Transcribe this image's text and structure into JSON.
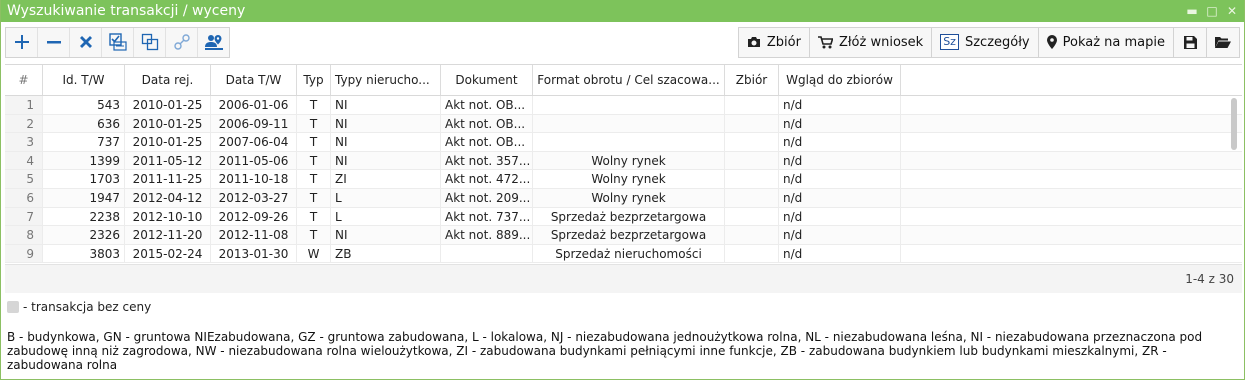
{
  "window": {
    "title": "Wyszukiwanie transakcji / wyceny"
  },
  "toolbar": {
    "left_icons": [
      "plus-icon",
      "minus-icon",
      "close-icon",
      "select-all-icon",
      "copy-icon",
      "link-icon",
      "map-person-icon"
    ],
    "right": {
      "zbior": "Zbiór",
      "wniosek": "Złóż wniosek",
      "szczegoly_badge": "Sz",
      "szczegoly": "Szczegóły",
      "mapa": "Pokaż na mapie"
    }
  },
  "grid": {
    "columns": [
      "#",
      "Id. T/W",
      "Data rej.",
      "Data T/W",
      "Typ",
      "Typy nierucho...",
      "Dokument",
      "Format obrotu / Cel szacowa...",
      "Zbiór",
      "Wgląd do zbiorów"
    ],
    "rows": [
      {
        "n": "1",
        "id": "543",
        "rej": "2010-01-25",
        "tw": "2006-01-06",
        "typ": "T",
        "typy": "NI",
        "dok": "Akt not. OB...",
        "format": "",
        "zbior": "",
        "wglad": "n/d"
      },
      {
        "n": "2",
        "id": "636",
        "rej": "2010-01-25",
        "tw": "2006-09-11",
        "typ": "T",
        "typy": "NI",
        "dok": "Akt not. OB...",
        "format": "",
        "zbior": "",
        "wglad": "n/d"
      },
      {
        "n": "3",
        "id": "737",
        "rej": "2010-01-25",
        "tw": "2007-06-04",
        "typ": "T",
        "typy": "NI",
        "dok": "Akt not. OB...",
        "format": "",
        "zbior": "",
        "wglad": "n/d"
      },
      {
        "n": "4",
        "id": "1399",
        "rej": "2011-05-12",
        "tw": "2011-05-06",
        "typ": "T",
        "typy": "NI",
        "dok": "Akt not. 357...",
        "format": "Wolny rynek",
        "zbior": "",
        "wglad": "n/d"
      },
      {
        "n": "5",
        "id": "1703",
        "rej": "2011-11-25",
        "tw": "2011-10-18",
        "typ": "T",
        "typy": "ZI",
        "dok": "Akt not. 472...",
        "format": "Wolny rynek",
        "zbior": "",
        "wglad": "n/d"
      },
      {
        "n": "6",
        "id": "1947",
        "rej": "2012-04-12",
        "tw": "2012-03-27",
        "typ": "T",
        "typy": "L",
        "dok": "Akt not. 209...",
        "format": "Wolny rynek",
        "zbior": "",
        "wglad": "n/d"
      },
      {
        "n": "7",
        "id": "2238",
        "rej": "2012-10-10",
        "tw": "2012-09-26",
        "typ": "T",
        "typy": "L",
        "dok": "Akt not. 737...",
        "format": "Sprzedaż bezprzetargowa",
        "zbior": "",
        "wglad": "n/d"
      },
      {
        "n": "8",
        "id": "2326",
        "rej": "2012-11-20",
        "tw": "2012-11-08",
        "typ": "T",
        "typy": "NI",
        "dok": "Akt not. 889...",
        "format": "Sprzedaż bezprzetargowa",
        "zbior": "",
        "wglad": "n/d"
      },
      {
        "n": "9",
        "id": "3803",
        "rej": "2015-02-24",
        "tw": "2013-01-30",
        "typ": "W",
        "typy": "ZB",
        "dok": "",
        "format": "Sprzedaż nieruchomości",
        "zbior": "",
        "wglad": "n/d"
      }
    ],
    "pager": "1-4 z 30"
  },
  "legend": {
    "swatch_label": "- transakcja bez ceny",
    "types_text": "B - budynkowa, GN - gruntowa NIEzabudowana, GZ - gruntowa zabudowana, L - lokalowa, NJ - niezabudowana jednoużytkowa rolna, NL - niezabudowana leśna, NI - niezabudowana przeznaczona pod zabudowę inną niż zagrodowa, NW - niezabudowana rolna wieloużytkowa, ZI - zabudowana budynkami pełniącymi inne funkcje, ZB - zabudowana budynkiem lub budynkami mieszkalnymi, ZR - zabudowana rolna"
  },
  "colors": {
    "titlebar": "#7dc35b",
    "icon_blue": "#1f66b3"
  }
}
